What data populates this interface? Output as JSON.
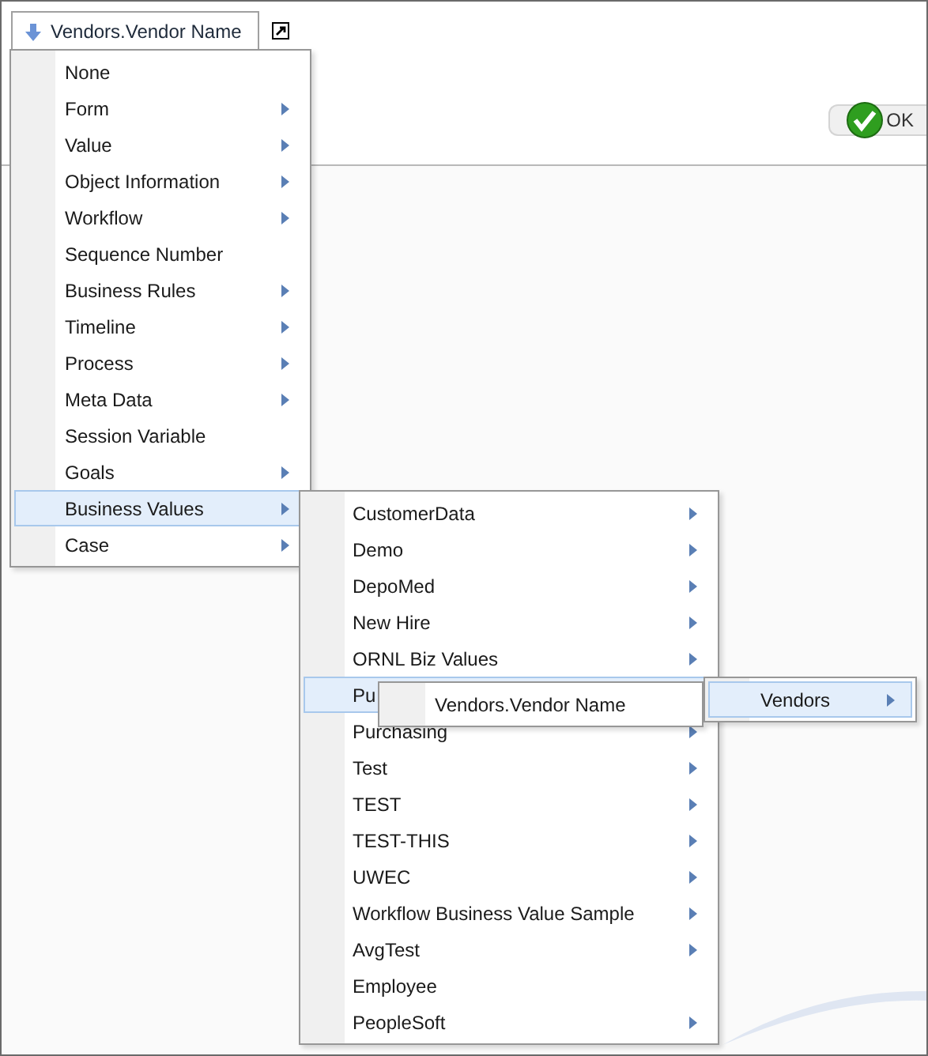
{
  "field_tab": {
    "label": "Vendors.Vendor Name"
  },
  "ok_button": {
    "label": "OK"
  },
  "menus": [
    {
      "items": [
        {
          "label": "None",
          "submenu": false,
          "selected": false
        },
        {
          "label": "Form",
          "submenu": true,
          "selected": false
        },
        {
          "label": "Value",
          "submenu": true,
          "selected": false
        },
        {
          "label": "Object Information",
          "submenu": true,
          "selected": false
        },
        {
          "label": "Workflow",
          "submenu": true,
          "selected": false
        },
        {
          "label": "Sequence Number",
          "submenu": false,
          "selected": false
        },
        {
          "label": "Business Rules",
          "submenu": true,
          "selected": false
        },
        {
          "label": "Timeline",
          "submenu": true,
          "selected": false
        },
        {
          "label": "Process",
          "submenu": true,
          "selected": false
        },
        {
          "label": "Meta Data",
          "submenu": true,
          "selected": false
        },
        {
          "label": "Session Variable",
          "submenu": false,
          "selected": false
        },
        {
          "label": "Goals",
          "submenu": true,
          "selected": false
        },
        {
          "label": "Business Values",
          "submenu": true,
          "selected": true
        },
        {
          "label": "Case",
          "submenu": true,
          "selected": false
        }
      ]
    },
    {
      "items": [
        {
          "label": "CustomerData",
          "submenu": true,
          "selected": false
        },
        {
          "label": "Demo",
          "submenu": true,
          "selected": false
        },
        {
          "label": "DepoMed",
          "submenu": true,
          "selected": false
        },
        {
          "label": "New Hire",
          "submenu": true,
          "selected": false
        },
        {
          "label": "ORNL Biz Values",
          "submenu": true,
          "selected": false
        },
        {
          "label": "Pu",
          "submenu": false,
          "selected": true
        },
        {
          "label": "Purchasing",
          "submenu": true,
          "selected": false
        },
        {
          "label": "Test",
          "submenu": true,
          "selected": false
        },
        {
          "label": "TEST",
          "submenu": true,
          "selected": false
        },
        {
          "label": "TEST-THIS",
          "submenu": true,
          "selected": false
        },
        {
          "label": "UWEC",
          "submenu": true,
          "selected": false
        },
        {
          "label": "Workflow Business Value Sample",
          "submenu": true,
          "selected": false
        },
        {
          "label": "AvgTest",
          "submenu": true,
          "selected": false
        },
        {
          "label": "Employee",
          "submenu": false,
          "selected": false
        },
        {
          "label": "PeopleSoft",
          "submenu": true,
          "selected": false
        }
      ]
    },
    {
      "items": [
        {
          "label": "Vendors.Vendor Name",
          "submenu": false,
          "selected": false
        }
      ]
    },
    {
      "items": [
        {
          "label": "Vendors",
          "submenu": true,
          "selected": true
        }
      ]
    }
  ]
}
